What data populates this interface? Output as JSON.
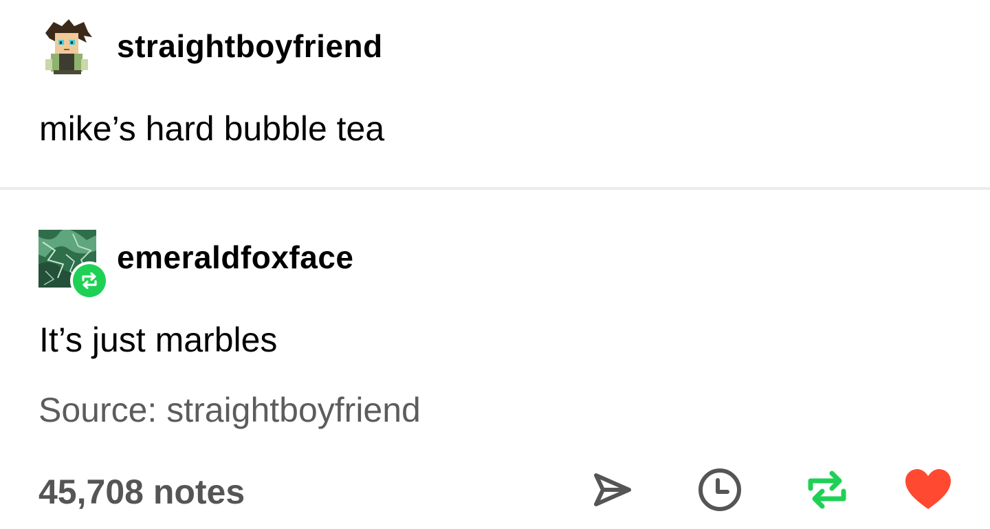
{
  "original_post": {
    "username": "straightboyfriend",
    "text": "mike’s hard bubble tea"
  },
  "reblog": {
    "username": "emeraldfoxface",
    "text": "It’s just marbles",
    "source_label": "Source: straightboyfriend"
  },
  "footer": {
    "notes": "45,708 notes",
    "actions": [
      "share-icon",
      "schedule-icon",
      "reblog-icon",
      "like-heart-icon"
    ]
  },
  "colors": {
    "reblog_green": "#1ed155",
    "like_red": "#ff4930",
    "muted_text": "#5c5c5c",
    "divider": "#ececec"
  }
}
